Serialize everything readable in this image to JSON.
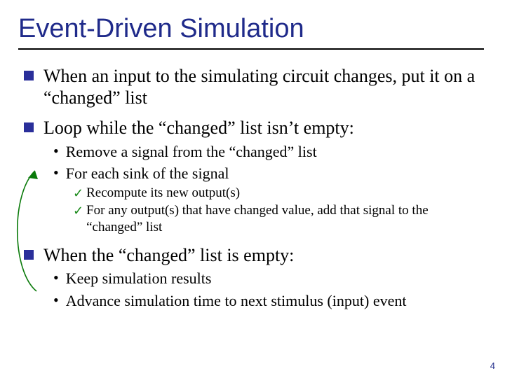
{
  "title": "Event-Driven Simulation",
  "bullets": {
    "b1": "When an input to the simulating circuit changes, put it on a “changed” list",
    "b2": "Loop while the “changed” list isn’t empty:",
    "b2_s1": "Remove a signal from the “changed” list",
    "b2_s2": "For each sink of the signal",
    "b2_s2_c1": "Recompute its new output(s)",
    "b2_s2_c2": "For any output(s) that have changed value, add that signal to the “changed” list",
    "b3": "When the “changed” list is empty:",
    "b3_s1": " Keep simulation results",
    "b3_s2": "Advance simulation time to next stimulus (input) event"
  },
  "page_number": "4"
}
